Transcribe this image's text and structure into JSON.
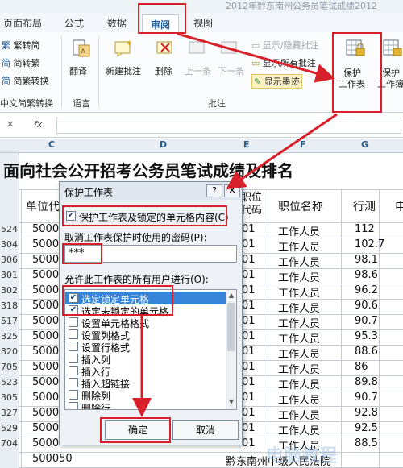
{
  "window": {
    "title": "2012年黔东南州公务员笔试成绩2012"
  },
  "tabs": [
    {
      "label": "页面布局"
    },
    {
      "label": "公式"
    },
    {
      "label": "数据"
    },
    {
      "label": "审阅",
      "active": true
    },
    {
      "label": "视图"
    }
  ],
  "ribbon": {
    "chinese_group": {
      "label": "中文简繁转换",
      "items": [
        "繁转简",
        "简转繁",
        "简繁转换"
      ]
    },
    "language_group": {
      "label": "语言",
      "translate": "翻译"
    },
    "comments_group": {
      "label": "批注",
      "new": "新建批注",
      "delete": "删除",
      "prev": "上一条",
      "next": "下一条",
      "show_hide": "显示/隐藏批注",
      "show_all": "显示所有批注",
      "show_ink": "显示墨迹"
    },
    "protect_sheet": {
      "line1": "保护",
      "line2": "工作表"
    },
    "protect_workbook": {
      "line1": "保护",
      "line2": "工作簿"
    }
  },
  "formula_bar": {
    "fx_label": "fx",
    "cancel": "✕",
    "confirm": "✓"
  },
  "sheet": {
    "columns": [
      "C",
      "D",
      "E",
      "F",
      "G"
    ],
    "title": "面向社会公开招考公务员笔试成绩及排名",
    "headers": {
      "unit_code": "单位代",
      "job_code": "职位代码",
      "job_name": "职位名称",
      "aptitude": "行测",
      "last": "申"
    },
    "rows": [
      {
        "row": "524",
        "c": "5000",
        "e": "01",
        "f": "工作人员",
        "g": "112"
      },
      {
        "row": "304",
        "c": "5000",
        "e": "01",
        "f": "工作人员",
        "g": "102.7"
      },
      {
        "row": "306",
        "c": "5000",
        "e": "01",
        "f": "工作人员",
        "g": "98.1"
      },
      {
        "row": "301",
        "c": "5000",
        "e": "01",
        "f": "工作人员",
        "g": "98.6"
      },
      {
        "row": "302",
        "c": "5000",
        "e": "01",
        "f": "工作人员",
        "g": "96.2"
      },
      {
        "row": "318",
        "c": "5000",
        "e": "01",
        "f": "工作人员",
        "g": "90.6"
      },
      {
        "row": "517",
        "c": "5000",
        "e": "01",
        "f": "工作人员",
        "g": "90.7"
      },
      {
        "row": "325",
        "c": "5000",
        "e": "01",
        "f": "工作人员",
        "g": "95.3"
      },
      {
        "row": "320",
        "c": "5000",
        "e": "01",
        "f": "工作人员",
        "g": "88.6"
      },
      {
        "row": "705",
        "c": "5000",
        "e": "01",
        "f": "工作人员",
        "g": "86"
      },
      {
        "row": "523",
        "c": "5000",
        "e": "01",
        "f": "工作人员",
        "g": "89.8"
      },
      {
        "row": "305",
        "c": "5000",
        "e": "01",
        "f": "工作人员",
        "g": "90.7"
      },
      {
        "row": "327",
        "c": "5000",
        "e": "01",
        "f": "工作人员",
        "g": "92.8"
      },
      {
        "row": "529",
        "c": "5000",
        "e": "01",
        "f": "工作人员",
        "g": "92.5"
      },
      {
        "row": "704",
        "c": "5000",
        "e": "01",
        "f": "工作人员",
        "g": "88.5"
      },
      {
        "row": "",
        "c": "500050",
        "e": "",
        "f": "黔东南州中级人民法院",
        "g": ""
      }
    ]
  },
  "dialog": {
    "title": "保护工作表",
    "help": "?",
    "close": "✕",
    "protect_check": "保护工作表及锁定的单元格内容(C)",
    "password_label": "取消工作表保护时使用的密码(P):",
    "password_value": "***",
    "allow_label": "允许此工作表的所有用户进行(O):",
    "permissions": [
      {
        "label": "选定锁定单元格",
        "checked": true,
        "selected": true
      },
      {
        "label": "选定未锁定的单元格",
        "checked": true,
        "selected": false
      },
      {
        "label": "设置单元格格式",
        "checked": false,
        "selected": false
      },
      {
        "label": "设置列格式",
        "checked": false,
        "selected": false
      },
      {
        "label": "设置行格式",
        "checked": false,
        "selected": false
      },
      {
        "label": "插入列",
        "checked": false,
        "selected": false
      },
      {
        "label": "插入行",
        "checked": false,
        "selected": false
      },
      {
        "label": "插入超链接",
        "checked": false,
        "selected": false
      },
      {
        "label": "删除列",
        "checked": false,
        "selected": false
      },
      {
        "label": "删除行",
        "checked": false,
        "selected": false
      }
    ],
    "ok": "确定",
    "cancel": "取消"
  },
  "colors": {
    "annotation_red": "#d8202a",
    "selection_blue": "#3584d9",
    "accent": "#1e5f9e"
  },
  "watermark": "电脑教程"
}
